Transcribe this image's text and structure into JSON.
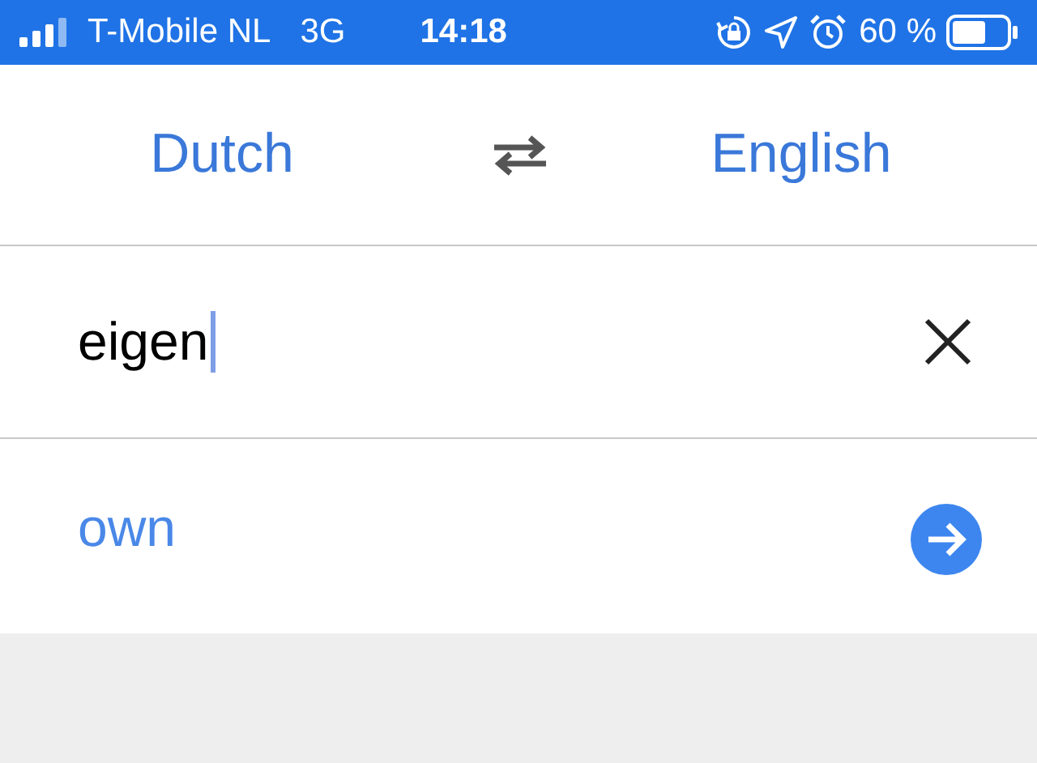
{
  "status_bar": {
    "carrier": "T-Mobile NL",
    "network": "3G",
    "time": "14:18",
    "battery": "60 %"
  },
  "languages": {
    "source": "Dutch",
    "target": "English"
  },
  "input": {
    "value": "eigen"
  },
  "result": {
    "translation": "own"
  }
}
